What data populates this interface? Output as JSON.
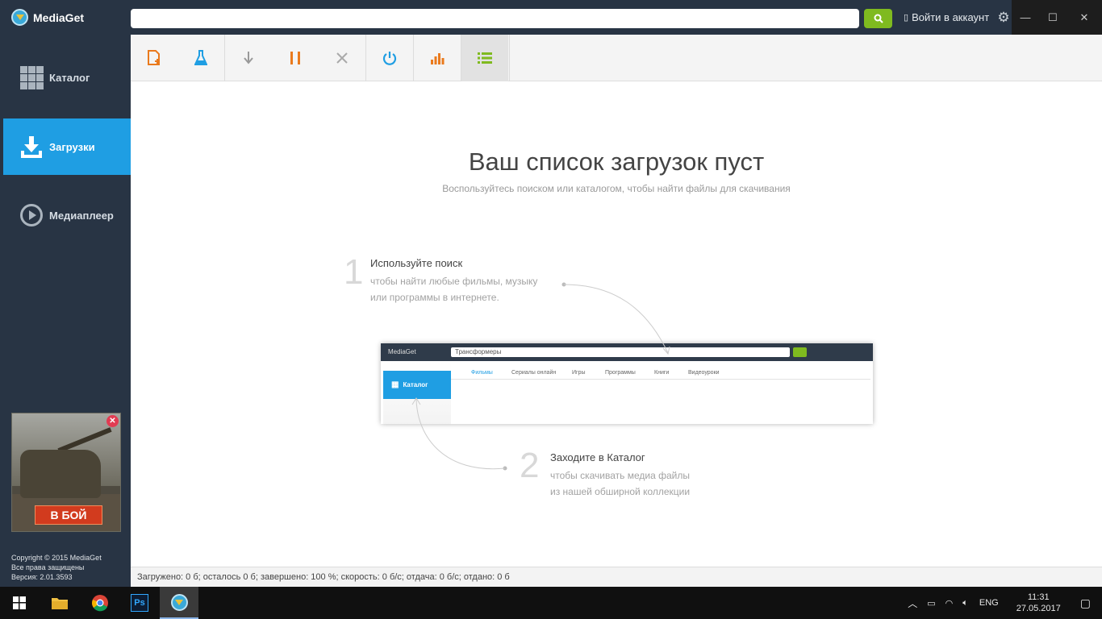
{
  "app": {
    "name": "MediaGet"
  },
  "header": {
    "search_placeholder": "",
    "login_label": "Войти в аккаунт"
  },
  "sidebar": {
    "items": [
      {
        "label": "Каталог"
      },
      {
        "label": "Загрузки"
      },
      {
        "label": "Медиаплеер"
      }
    ],
    "ad_button": "В БОЙ",
    "copyright_lines": [
      "Copyright © 2015 MediaGet",
      "Все права защищены",
      "Версия: 2.01.3593"
    ]
  },
  "main": {
    "empty_title": "Ваш список загрузок пуст",
    "empty_subtitle": "Воспользуйтесь поиском или каталогом, чтобы найти файлы для скачивания",
    "step1": {
      "num": "1",
      "title": "Используйте поиск",
      "desc1": "чтобы найти любые фильмы, музыку",
      "desc2": "или программы в интернете."
    },
    "step2": {
      "num": "2",
      "title": "Заходите в Каталог",
      "desc1": "чтобы скачивать медиа файлы",
      "desc2": "из нашей обширной коллекции"
    },
    "mini": {
      "logo": "MediaGet",
      "search_text": "Трансформеры",
      "catalog": "Каталог",
      "tabs": [
        "Фильмы",
        "Сериалы онлайн",
        "Игры",
        "Программы",
        "Книги",
        "Видеоуроки"
      ]
    }
  },
  "statusbar": {
    "text": "Загружено: 0 б; осталось 0 б; завершено: 100 %; скорость: 0 б/с; отдача: 0 б/с; отдано: 0 б"
  },
  "taskbar": {
    "lang": "ENG",
    "time": "11:31",
    "date": "27.05.2017"
  },
  "colors": {
    "accent": "#1f9ee3",
    "sidebar": "#283444",
    "search_button": "#7fba1f"
  }
}
